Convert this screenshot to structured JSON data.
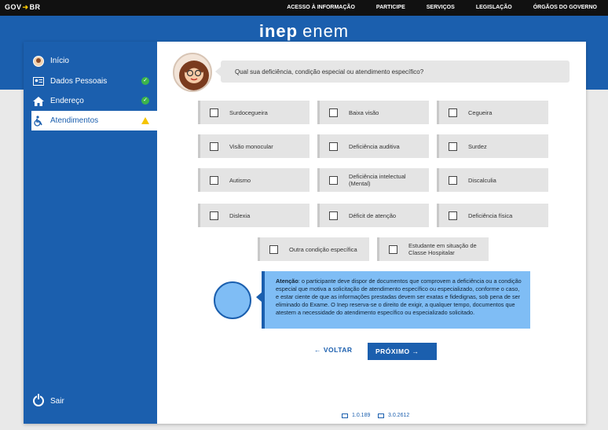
{
  "govbar": {
    "brand_left": "GOV",
    "brand_right": "BR",
    "links": [
      "ACESSO À INFORMAÇÃO",
      "PARTICIPE",
      "SERVIÇOS",
      "LEGISLAÇÃO",
      "ÓRGÃOS DO GOVERNO"
    ]
  },
  "logo": {
    "inep": "inep",
    "enem": "enem"
  },
  "sidebar": {
    "items": [
      {
        "label": "Início",
        "icon": "avatar-icon",
        "status": "none"
      },
      {
        "label": "Dados Pessoais",
        "icon": "id-card-icon",
        "status": "ok"
      },
      {
        "label": "Endereço",
        "icon": "home-icon",
        "status": "ok"
      },
      {
        "label": "Atendimentos",
        "icon": "wheelchair-icon",
        "status": "warning"
      }
    ],
    "logout": "Sair"
  },
  "question": "Qual sua deficiência, condição especial ou atendimento específico?",
  "options": [
    "Surdocegueira",
    "Baixa visão",
    "Cegueira",
    "Visão monocular",
    "Deficiência auditiva",
    "Surdez",
    "Autismo",
    "Deficiência intelectual (Mental)",
    "Discalculia",
    "Dislexia",
    "Déficit de atenção",
    "Deficiência física",
    "Outra condição específica",
    "Estudante em situação de Classe Hospitalar"
  ],
  "notice": {
    "lead": "Atenção",
    "text": ": o participante deve dispor de documentos que comprovem a deficiência ou a condição especial que motiva a solicitação de atendimento específico ou especializado, conforme o caso, e estar ciente de que as informações prestadas devem ser exatas e fidedignas, sob pena de ser eliminado do Exame. O Inep reserva-se o direito de exigir, a qualquer tempo, documentos que atestem a necessidade do atendimento específico ou especializado solicitado."
  },
  "nav": {
    "back": "← VOLTAR",
    "next": "PRÓXIMO   →"
  },
  "versions": {
    "left": "1.0.189",
    "right": "3.0.2612"
  },
  "colors": {
    "primary": "#1b5fae",
    "notice": "#7fbdf5",
    "ok": "#3cb44b",
    "warning": "#f5c400"
  }
}
